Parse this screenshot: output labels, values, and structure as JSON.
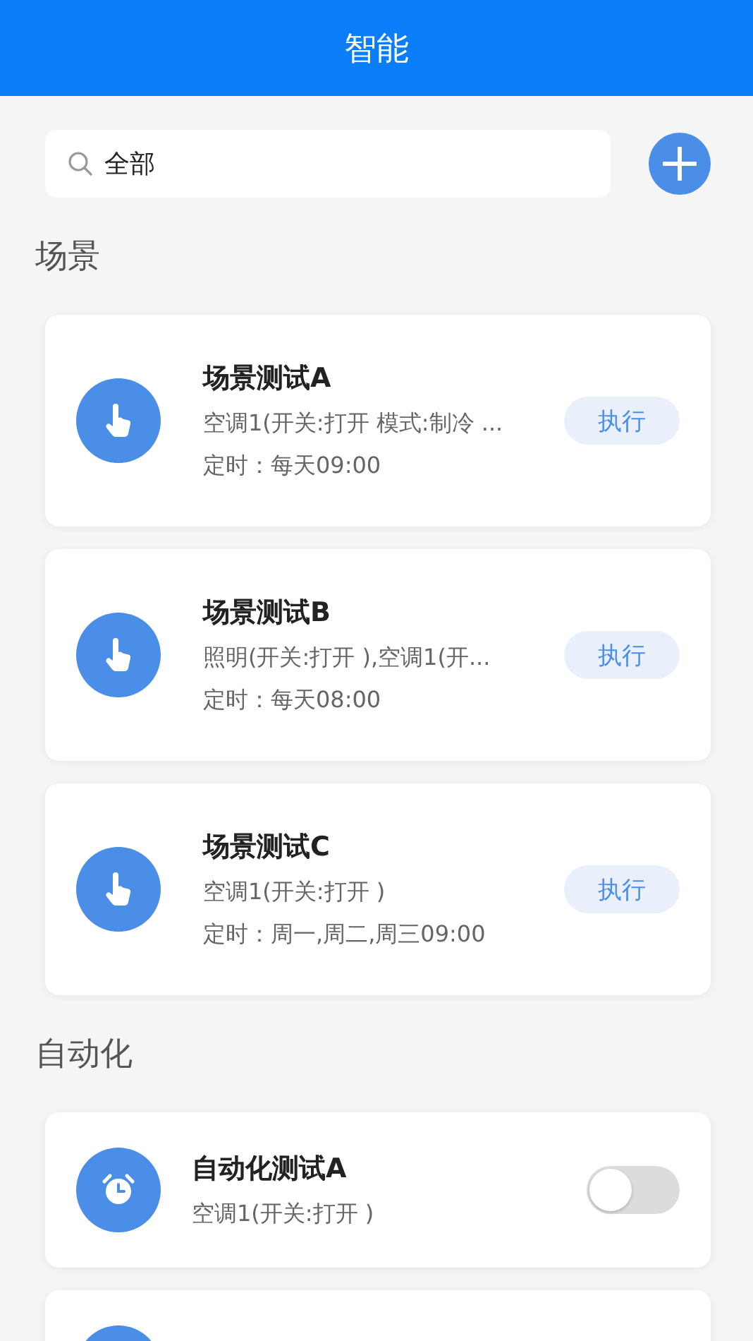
{
  "header": {
    "title": "智能"
  },
  "search": {
    "value": "全部"
  },
  "sections": [
    {
      "title": "场景",
      "kind": "scene",
      "items": [
        {
          "name": "场景测试A",
          "detail": "空调1(开关:打开 模式:制冷 ...",
          "schedule": "定时：每天09:00",
          "action": "执行"
        },
        {
          "name": "场景测试B",
          "detail": "照明(开关:打开 ),空调1(开...",
          "schedule": "定时：每天08:00",
          "action": "执行"
        },
        {
          "name": "场景测试C",
          "detail": "空调1(开关:打开 )",
          "schedule": "定时：周一,周二,周三09:00",
          "action": "执行"
        }
      ]
    },
    {
      "title": "自动化",
      "kind": "automation",
      "items": [
        {
          "kind": "timer",
          "name": "自动化测试A",
          "detail": "空调1(开关:打开 )",
          "on": false
        },
        {
          "kind": "partial"
        }
      ]
    }
  ]
}
